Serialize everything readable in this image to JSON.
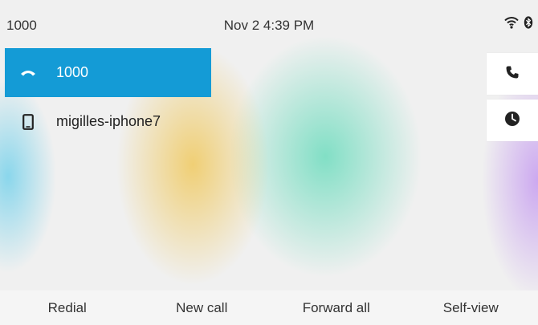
{
  "status": {
    "line_number": "1000",
    "datetime": "Nov 2 4:39 PM",
    "icons": [
      "wifi-icon",
      "bluetooth-icon"
    ]
  },
  "lines": [
    {
      "label": "1000",
      "icon": "handset-icon",
      "state": "active"
    },
    {
      "label": "migilles-iphone7",
      "icon": "mobile-phone-icon",
      "state": "idle"
    }
  ],
  "side_buttons": [
    {
      "icon": "phone-icon"
    },
    {
      "icon": "clock-icon"
    }
  ],
  "softkeys": {
    "redial": "Redial",
    "new_call": "New call",
    "forward_all": "Forward all",
    "self_view": "Self-view"
  },
  "colors": {
    "active_line": "#149bd6",
    "tile": "#ffffff",
    "softkey_bar": "#f5f5f5"
  }
}
